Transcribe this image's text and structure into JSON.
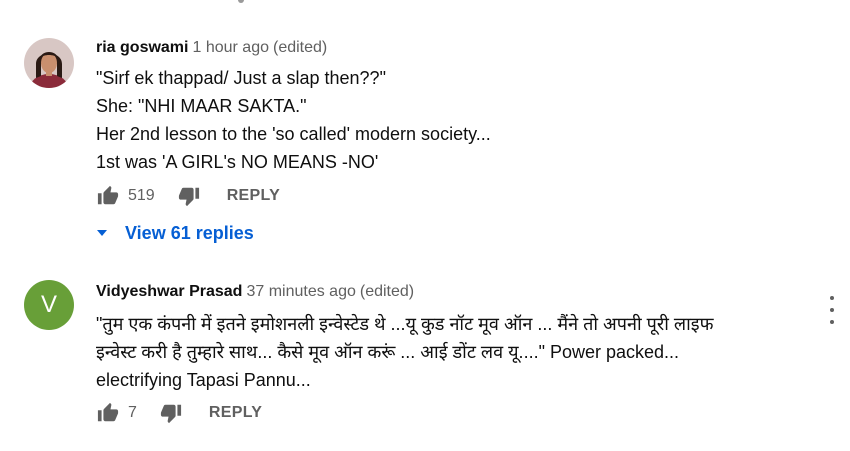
{
  "comments": [
    {
      "author": "ria goswami",
      "time": "1 hour ago",
      "edited": "(edited)",
      "avatar": {
        "type": "photo",
        "bg": "#d9c6c2"
      },
      "lines": [
        "\"Sirf ek thappad/ Just a slap then??\"",
        "She: \"NHI MAAR SAKTA.\"",
        "Her 2nd lesson to the 'so called' modern society...",
        "1st was 'A GIRL's NO MEANS -NO'"
      ],
      "likes": "519",
      "reply_label": "REPLY",
      "view_replies": "View 61 replies"
    },
    {
      "author": "Vidyeshwar Prasad",
      "time": "37 minutes ago",
      "edited": "(edited)",
      "avatar": {
        "type": "letter",
        "letter": "V",
        "bg": "#689f38"
      },
      "lines": [
        "\"तुम एक कंपनी में इतने इमोशनली इन्वेस्टेड थे ...यू कुड नॉट मूव ऑन ... मैंने तो अपनी पूरी लाइफ",
        "इन्वेस्ट करी है तुम्हारे साथ...  कैसे मूव ऑन करूं ... आई डोंट लव यू....\" Power packed...",
        "electrifying Tapasi Pannu..."
      ],
      "likes": "7",
      "reply_label": "REPLY"
    }
  ],
  "icons": {
    "like": "thumb-up-icon",
    "dislike": "thumb-down-icon",
    "expand": "caret-down-icon",
    "menu": "more-vert-icon"
  },
  "colors": {
    "link_blue": "#065fd4",
    "secondary_text": "#606060",
    "avatar_green": "#689f38"
  }
}
